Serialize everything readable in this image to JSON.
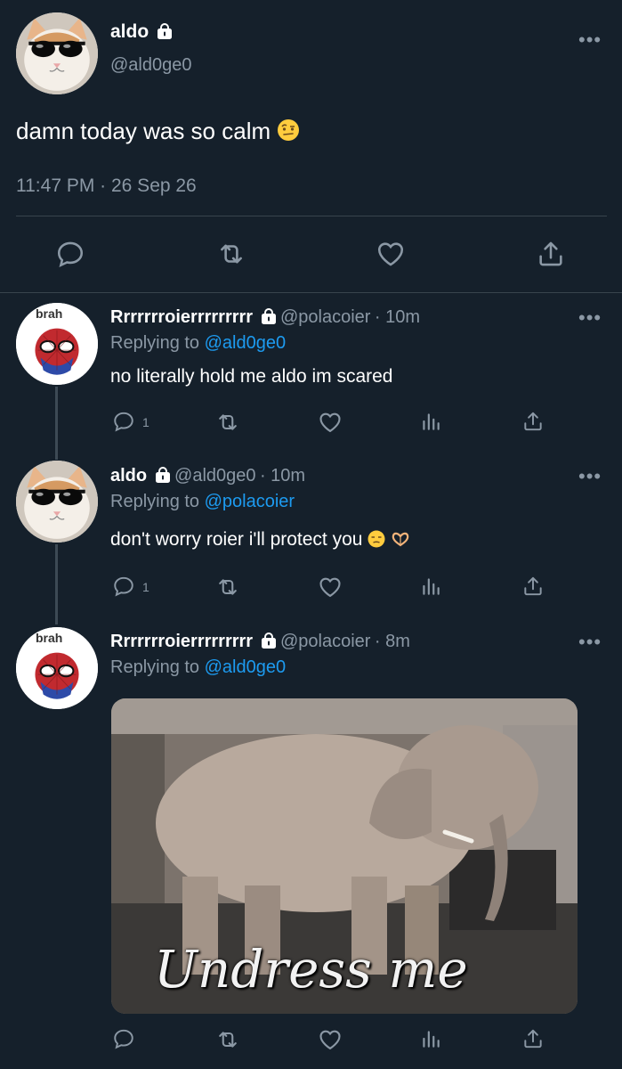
{
  "main_tweet": {
    "author_name": "aldo",
    "author_handle": "@ald0ge0",
    "text": "damn today was so calm",
    "emoji": "raised-eyebrow-emoji",
    "timestamp": "11:47 PM · 26 Sep 26",
    "actions": [
      "reply-icon",
      "retweet-icon",
      "like-icon",
      "share-icon"
    ]
  },
  "replies": [
    {
      "author_name": "Rrrrrrroierrrrrrrrr",
      "author_handle": "@polacoier",
      "time": "· 10m",
      "avatar_label": "brah",
      "replying_prefix": "Replying to",
      "replying_to": "@ald0ge0",
      "text": "no literally hold me aldo im scared",
      "reply_count": "1"
    },
    {
      "author_name": "aldo",
      "author_handle": "@ald0ge0",
      "time": "· 10m",
      "replying_prefix": "Replying to",
      "replying_to": "@polacoier",
      "text": "don't worry roier i'll protect you",
      "reply_count": "1"
    },
    {
      "author_name": "Rrrrrrroierrrrrrrrr",
      "author_handle": "@polacoier",
      "time": "· 8m",
      "avatar_label": "brah",
      "replying_prefix": "Replying to",
      "replying_to": "@ald0ge0",
      "media_caption": "Undress me"
    }
  ],
  "colors": {
    "background": "#15202b",
    "link": "#1d9bf0",
    "muted": "#8b98a5",
    "divider": "#38444d"
  }
}
